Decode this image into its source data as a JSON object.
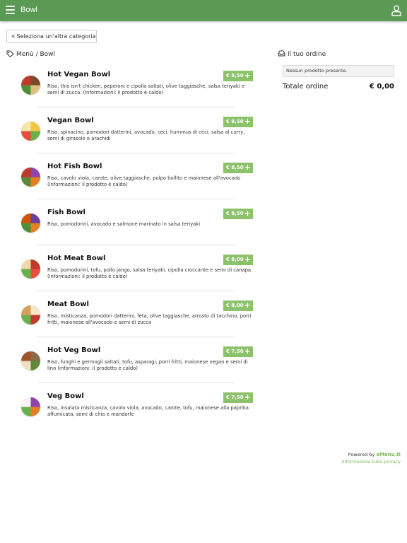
{
  "header": {
    "title": "Bowl",
    "menu_icon": "hamburger-icon",
    "user_icon": "user-icon"
  },
  "back_button": {
    "chevron": "«",
    "label": "Seleziona un'altra categoria"
  },
  "breadcrumb": {
    "icon": "tag-icon",
    "text": "Menù / Bowl"
  },
  "order": {
    "icon": "tray-icon",
    "title": "Il tuo ordine",
    "empty_text": "Nessun prodotto presente.",
    "total_label": "Totale ordine",
    "total_value": "€ 0,00"
  },
  "items": [
    {
      "name": "Hot Vegan Bowl",
      "price": "€ 8,50",
      "description": "Riso, this isn't chicken, peperoni e cipolla saltati, olive taggiasche, salsa teriyaki e semi di zucca. (informazioni: il prodotto è caldo)",
      "colors": [
        "#7a4a2a",
        "#e0c080",
        "#4f8f3a",
        "#c0392b"
      ]
    },
    {
      "name": "Vegan Bowl",
      "price": "€ 8,50",
      "description": "Riso, spinacino, pomodori datterini, avocado, ceci, hummus di ceci, salsa al curry, semi di girasole e arachidi",
      "colors": [
        "#f4c542",
        "#6ab04c",
        "#e74c3c",
        "#f5e6a8"
      ]
    },
    {
      "name": "Hot Fish Bowl",
      "price": "€ 8,50",
      "description": "Riso, cavolo viola, carote, olive taggiasche, polpo bollito e maionese all'avocado (informazioni: il prodotto è caldo)",
      "colors": [
        "#8e44ad",
        "#e67e22",
        "#5d8a3a",
        "#c0392b"
      ]
    },
    {
      "name": "Fish Bowl",
      "price": "€ 8,50",
      "description": "Riso, pomodorini, avocado e salmone marinato in salsa teriyaki",
      "colors": [
        "#6b3fa0",
        "#e67e22",
        "#4f8f3a",
        "#d35400"
      ]
    },
    {
      "name": "Hot Meat Bowl",
      "price": "€ 8,00",
      "description": "Riso, pomodorini, tofu, pollo jango, salsa teriyaki, cipolla croccante e semi di canapa. (informazioni: il prodotto è caldo)",
      "colors": [
        "#c0392b",
        "#e74c3c",
        "#6ab04c",
        "#f0d9a8"
      ]
    },
    {
      "name": "Meat Bowl",
      "price": "€ 8,00",
      "description": "Riso, misticanza, pomodori datterini, feta, olive taggiasche, arrosto di tacchino, porri fritti, maionese all'avocado e semi di zucca",
      "colors": [
        "#f5e6c8",
        "#c0392b",
        "#6ab04c",
        "#d4a05a"
      ]
    },
    {
      "name": "Hot Veg Bowl",
      "price": "€ 7,50",
      "description": "Riso, funghi e germogli saltati, tofu, asparagi, porri fritti, maionese vegan e semi di lino (informazioni: il prodotto è caldo)",
      "colors": [
        "#8b6b4a",
        "#5d8a3a",
        "#f0e0c0",
        "#a0522d"
      ]
    },
    {
      "name": "Veg Bowl",
      "price": "€ 7,50",
      "description": "Riso, insalata misticanza, cavolo viola, avocado, carote, tofu, maionese alla paprika affumicata, semi di chia e mandorle",
      "colors": [
        "#8e44ad",
        "#e67e22",
        "#6ab04c",
        "#f5f5f5"
      ]
    }
  ],
  "footer": {
    "powered_prefix": "Powered by",
    "brand": "xMenu.it",
    "privacy": "Informazioni sulla privacy"
  }
}
